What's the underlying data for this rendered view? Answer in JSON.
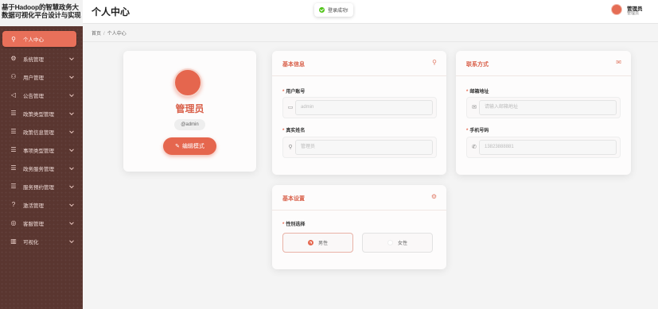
{
  "app": {
    "title": "基于Hadoop的智慧政务大数据可视化平台设计与实现",
    "page_title": "个人中心"
  },
  "toast": {
    "text": "登录成功!"
  },
  "user": {
    "name": "管理员",
    "role": "管理员"
  },
  "breadcrumb": {
    "home": "首页",
    "separator": "/",
    "current": "个人中心"
  },
  "sidebar": {
    "items": [
      {
        "label": "个人中心",
        "icon": "user-icon",
        "glyph": "⚲",
        "active": true,
        "chevron": false
      },
      {
        "label": "系统管理",
        "icon": "gear-icon",
        "glyph": "⚙",
        "active": false,
        "chevron": true
      },
      {
        "label": "用户管理",
        "icon": "users-icon",
        "glyph": "⚇",
        "active": false,
        "chevron": true
      },
      {
        "label": "公告管理",
        "icon": "megaphone-icon",
        "glyph": "◁",
        "active": false,
        "chevron": true
      },
      {
        "label": "政策类型管理",
        "icon": "list-icon",
        "glyph": "☰",
        "active": false,
        "chevron": true
      },
      {
        "label": "政策信息管理",
        "icon": "list-icon",
        "glyph": "☰",
        "active": false,
        "chevron": true
      },
      {
        "label": "事项类型管理",
        "icon": "list-icon",
        "glyph": "☰",
        "active": false,
        "chevron": true
      },
      {
        "label": "政务服务管理",
        "icon": "list-icon",
        "glyph": "☰",
        "active": false,
        "chevron": true
      },
      {
        "label": "服务预约管理",
        "icon": "list-icon",
        "glyph": "☰",
        "active": false,
        "chevron": true
      },
      {
        "label": "激活管理",
        "icon": "question-icon",
        "glyph": "?",
        "active": false,
        "chevron": true
      },
      {
        "label": "客服管理",
        "icon": "chat-icon",
        "glyph": "◎",
        "active": false,
        "chevron": true
      },
      {
        "label": "可视化",
        "icon": "chart-icon",
        "glyph": "▥",
        "active": false,
        "chevron": true
      }
    ]
  },
  "profile": {
    "name": "管理员",
    "handle": "@admin",
    "edit_button": "编辑模式"
  },
  "basic_info": {
    "title": "基本信息",
    "account_label": "用户账号",
    "account_value": "admin",
    "realname_label": "真实姓名",
    "realname_value": "管理员"
  },
  "contact": {
    "title": "联系方式",
    "email_label": "邮箱地址",
    "email_placeholder": "请输入邮箱地址",
    "phone_label": "手机号码",
    "phone_value": "13823888881"
  },
  "settings": {
    "title": "基本设置",
    "gender_label": "性别选择",
    "male": "男性",
    "female": "女性",
    "selected": "male"
  },
  "colors": {
    "accent": "#e5664e",
    "sidebar_bg": "#5a3630",
    "success": "#52c41a"
  }
}
